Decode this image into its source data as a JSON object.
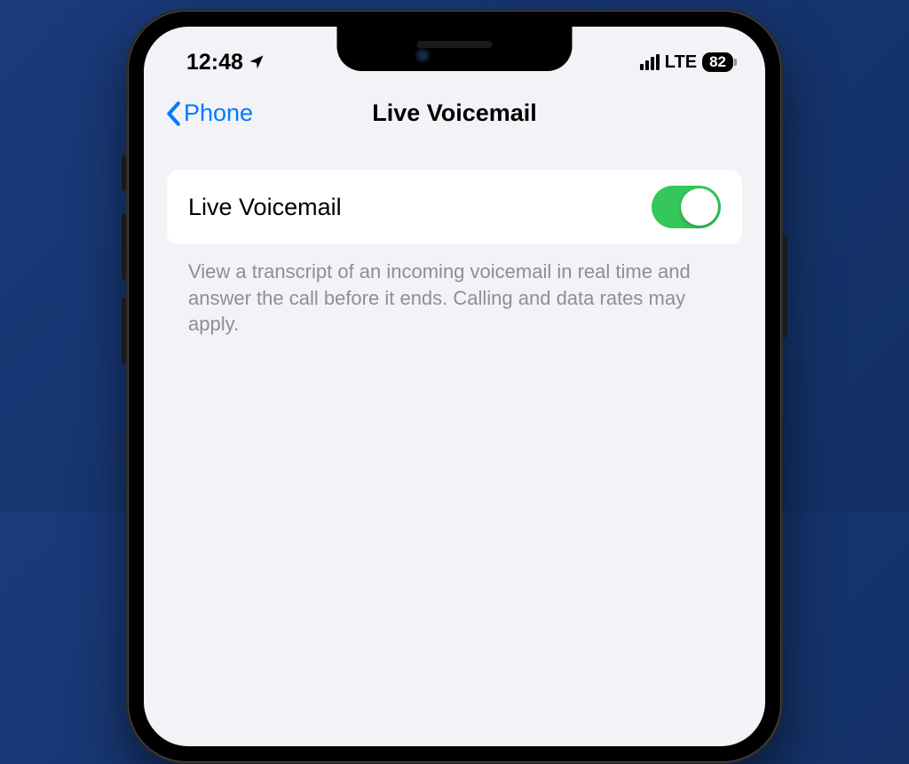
{
  "status": {
    "time": "12:48",
    "network": "LTE",
    "battery": "82"
  },
  "nav": {
    "back_label": "Phone",
    "title": "Live Voicemail"
  },
  "settings": {
    "toggle_label": "Live Voicemail",
    "toggle_on": true,
    "description": "View a transcript of an incoming voicemail in real time and answer the call before it ends. Calling and data rates may apply."
  },
  "colors": {
    "accent": "#007AFF",
    "toggle_active": "#34C759",
    "background": "#f2f2f7"
  }
}
